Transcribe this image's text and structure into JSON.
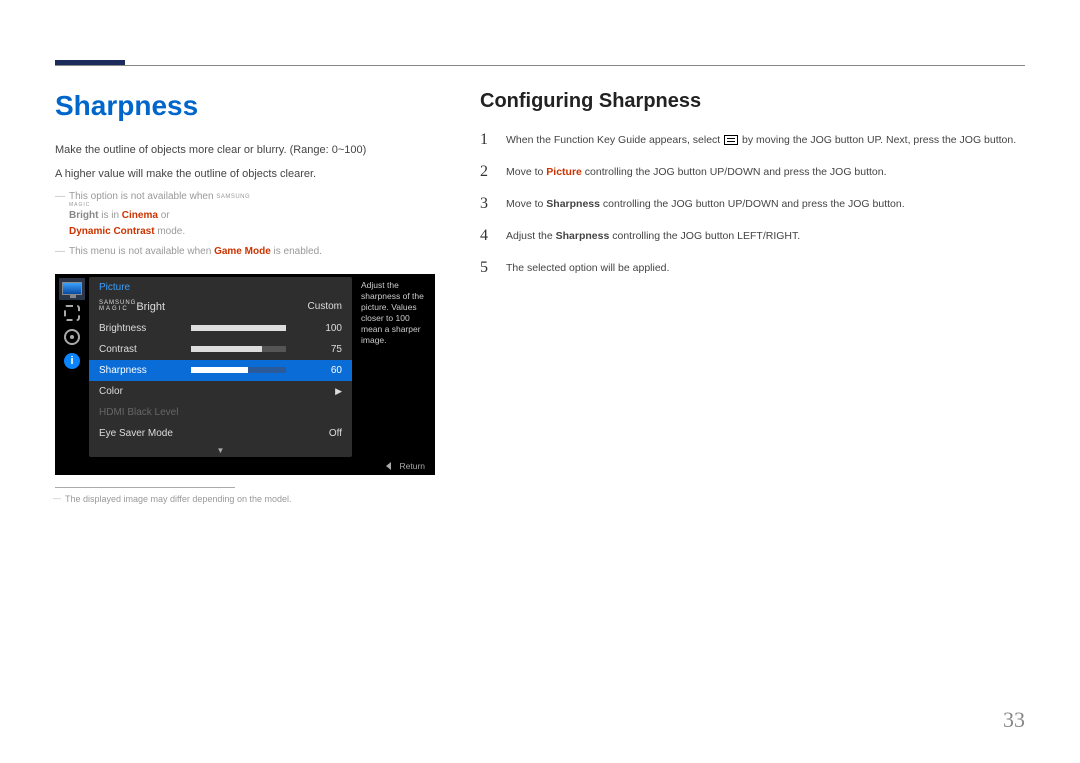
{
  "page_number": "33",
  "left": {
    "title": "Sharpness",
    "p1": "Make the outline of objects more clear or blurry. (Range: 0~100)",
    "p2": "A higher value will make the outline of objects clearer.",
    "note1_pre": "This option is not available when ",
    "samsung": "SAMSUNG",
    "magic": "MAGIC",
    "bright": "Bright",
    "note1_mid": " is in ",
    "cinema": "Cinema",
    "note1_or": " or ",
    "dyncontrast": "Dynamic Contrast",
    "note1_end": " mode.",
    "note2_pre": "This menu is not available when ",
    "gamemode": "Game Mode",
    "note2_end": " is enabled.",
    "footnote": "The displayed image may differ depending on the model."
  },
  "osd": {
    "header": "Picture",
    "tooltip": "Adjust the sharpness of the picture. Values closer to 100 mean a sharper image.",
    "rows": {
      "magicbright": {
        "label_top": "SAMSUNG",
        "label_bottom": "MAGIC",
        "label_suffix": "Bright",
        "value": "Custom"
      },
      "brightness": {
        "label": "Brightness",
        "value": "100",
        "pct": 100
      },
      "contrast": {
        "label": "Contrast",
        "value": "75",
        "pct": 75
      },
      "sharpness": {
        "label": "Sharpness",
        "value": "60",
        "pct": 60
      },
      "color": {
        "label": "Color",
        "arrow": "▶"
      },
      "hdmi": {
        "label": "HDMI Black Level"
      },
      "eyesaver": {
        "label": "Eye Saver Mode",
        "value": "Off"
      }
    },
    "scroll": "▼",
    "return": "Return",
    "info_glyph": "i"
  },
  "right": {
    "title": "Configuring Sharpness",
    "steps": {
      "s1": {
        "n": "1",
        "pre": "When the Function Key Guide appears, select ",
        "post": " by moving the JOG button UP. Next, press the JOG button."
      },
      "s2": {
        "n": "2",
        "pre": "Move to ",
        "picture": "Picture",
        "post": " controlling the JOG button UP/DOWN and press the JOG button."
      },
      "s3": {
        "n": "3",
        "pre": "Move to ",
        "sharpness": "Sharpness",
        "post": " controlling the JOG button UP/DOWN and press the JOG button."
      },
      "s4": {
        "n": "4",
        "pre": "Adjust the ",
        "sharpness": "Sharpness",
        "post": " controlling the JOG button LEFT/RIGHT."
      },
      "s5": {
        "n": "5",
        "text": "The selected option will be applied."
      }
    }
  }
}
